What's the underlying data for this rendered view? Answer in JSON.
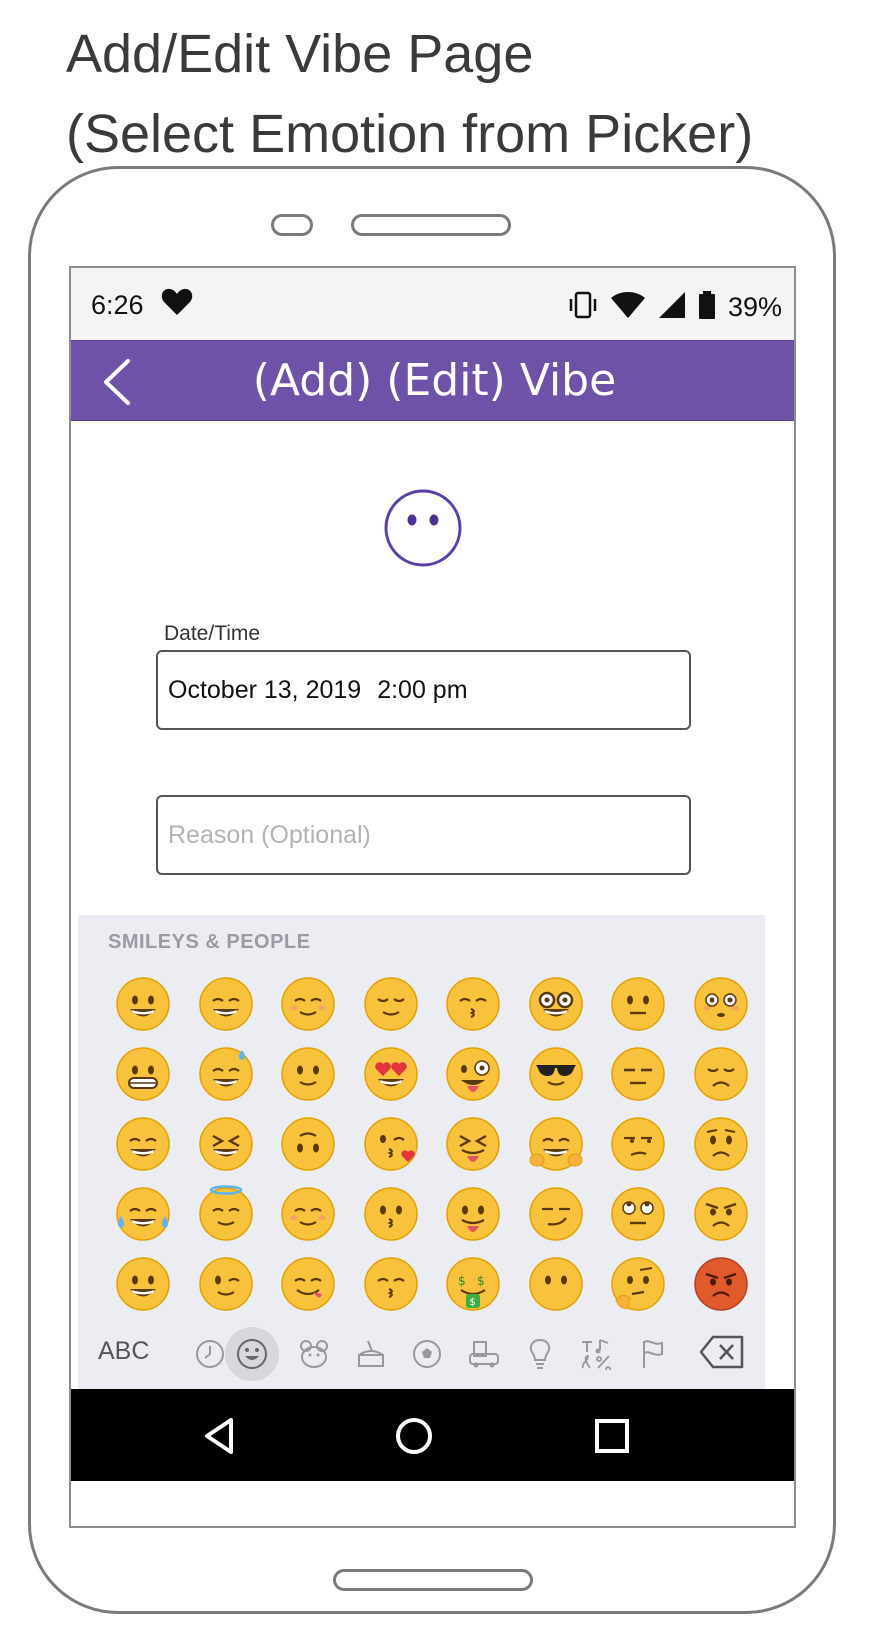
{
  "page": {
    "title_line1": "Add/Edit Vibe Page",
    "title_line2": "(Select Emotion from Picker)"
  },
  "status_bar": {
    "time": "6:26",
    "battery": "39%",
    "icons": [
      "heart-icon",
      "vibrate-icon",
      "wifi-icon",
      "signal-icon",
      "battery-icon"
    ]
  },
  "app_bar": {
    "title": "(Add) (Edit) Vibe",
    "color": "#6e52a8"
  },
  "form": {
    "date_label": "Date/Time",
    "date_value": "October 13, 2019",
    "time_value": "2:00 pm",
    "reason_placeholder": "Reason (Optional)",
    "reason_value": ""
  },
  "emoji_picker": {
    "category_title": "SMILEYS & PEOPLE",
    "rows": [
      [
        "grinning",
        "grin",
        "smile-blush",
        "relieved",
        "kissing-closed-eyes",
        "nerd",
        "neutral",
        "flushed"
      ],
      [
        "grimacing",
        "sweat-smile",
        "slight-smile",
        "heart-eyes",
        "zany",
        "sunglasses",
        "expressionless",
        "disappointed"
      ],
      [
        "beaming",
        "laughing",
        "upside-down",
        "blow-kiss",
        "squint-tongue",
        "hugging",
        "unamused",
        "worried"
      ],
      [
        "joy",
        "innocent",
        "blushing",
        "kissing",
        "tongue",
        "smirk",
        "eye-roll",
        "angry"
      ],
      [
        "smiley",
        "wink",
        "yum",
        "kissing-smiling-eyes",
        "money-mouth",
        "no-mouth",
        "thinking",
        "pouting"
      ]
    ],
    "keyboard_switch_label": "ABC",
    "categories": [
      "recent-icon",
      "smileys-icon",
      "animals-icon",
      "food-icon",
      "activity-icon",
      "travel-icon",
      "objects-icon",
      "symbols-icon",
      "flags-icon"
    ],
    "active_category": "smileys-icon"
  },
  "nav_bar": {
    "buttons": [
      "back-triangle-icon",
      "home-circle-icon",
      "recents-square-icon"
    ]
  }
}
